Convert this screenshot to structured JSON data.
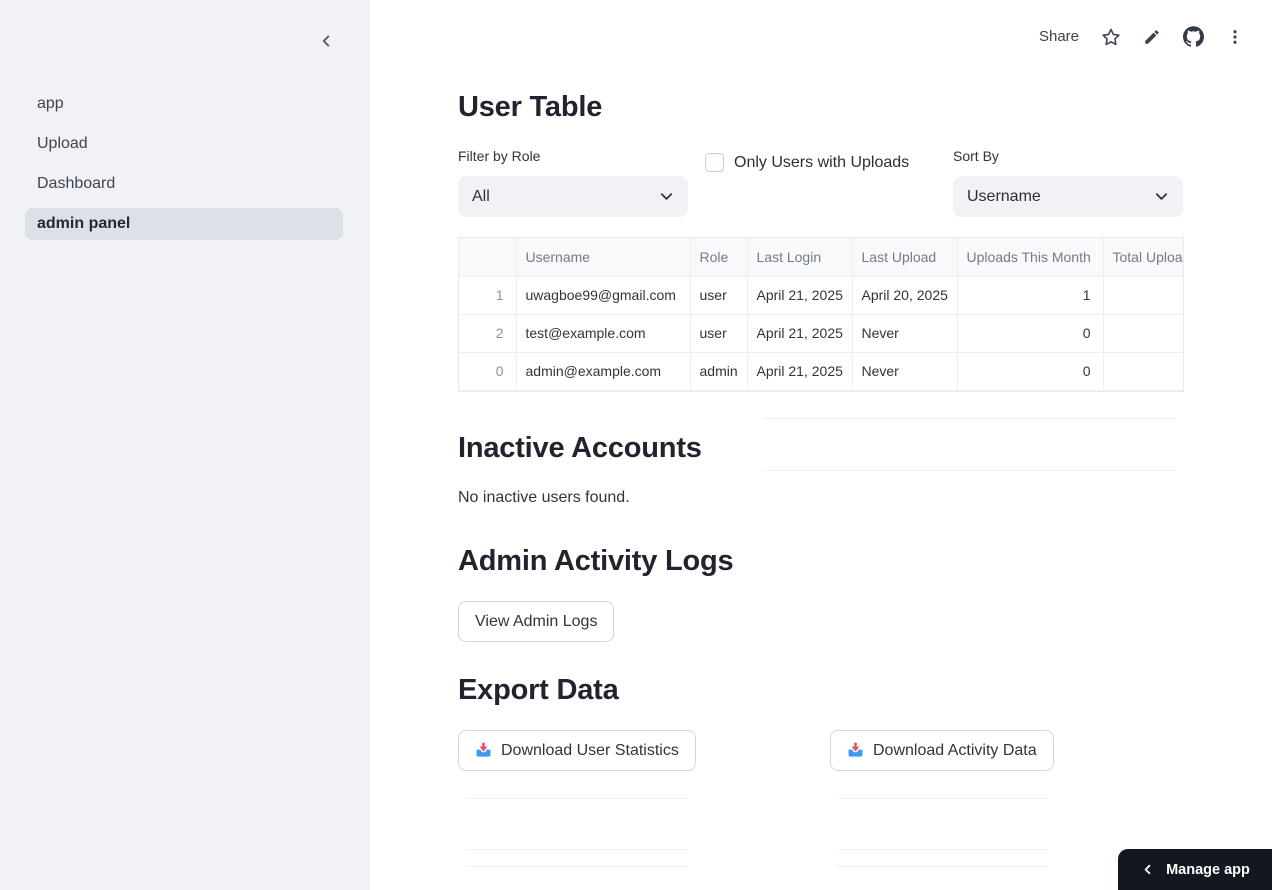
{
  "colors": {
    "sidebar_bg": "#f0f2f6",
    "sidebar_active_item_bg": "#dce0e9",
    "text_primary": "#31333f",
    "table_header_bg": "#f8f9fb",
    "manage_app_bg": "#131720",
    "download_icon_tray": "#3b9cf1",
    "download_icon_arrow": "#ee4d64"
  },
  "sidebar": {
    "collapse_icon": "chevron-left",
    "items": [
      {
        "label": "app",
        "active": false
      },
      {
        "label": "Upload",
        "active": false
      },
      {
        "label": "Dashboard",
        "active": false
      },
      {
        "label": "admin panel",
        "active": true
      }
    ]
  },
  "toolbar": {
    "share_label": "Share",
    "icons": [
      "star-icon",
      "edit-icon",
      "github-icon",
      "overflow-menu-icon"
    ]
  },
  "main": {
    "user_table": {
      "title": "User Table",
      "filter_role": {
        "label": "Filter by Role",
        "value": "All"
      },
      "uploads_filter": {
        "label": "Only Users with Uploads",
        "checked": false
      },
      "sort_by": {
        "label": "Sort By",
        "value": "Username"
      },
      "table": {
        "columns": [
          "",
          "Username",
          "Role",
          "Last Login",
          "Last Upload",
          "Uploads This Month",
          "Total Uploads"
        ],
        "rows": [
          {
            "index": "1",
            "username": "uwagboe99@gmail.com",
            "role": "user",
            "last_login": "April 21, 2025",
            "last_upload": "April 20, 2025",
            "uploads_this_month": "1",
            "total_uploads": ""
          },
          {
            "index": "2",
            "username": "test@example.com",
            "role": "user",
            "last_login": "April 21, 2025",
            "last_upload": "Never",
            "uploads_this_month": "0",
            "total_uploads": ""
          },
          {
            "index": "0",
            "username": "admin@example.com",
            "role": "admin",
            "last_login": "April 21, 2025",
            "last_upload": "Never",
            "uploads_this_month": "0",
            "total_uploads": ""
          }
        ]
      }
    },
    "inactive_accounts": {
      "title": "Inactive Accounts",
      "message": "No inactive users found."
    },
    "admin_logs": {
      "title": "Admin Activity Logs",
      "view_logs_label": "View Admin Logs"
    },
    "export_data": {
      "title": "Export Data",
      "buttons": [
        {
          "label": "Download User Statistics"
        },
        {
          "label": "Download Activity Data"
        }
      ]
    }
  },
  "manage_app": {
    "label": "Manage app"
  }
}
